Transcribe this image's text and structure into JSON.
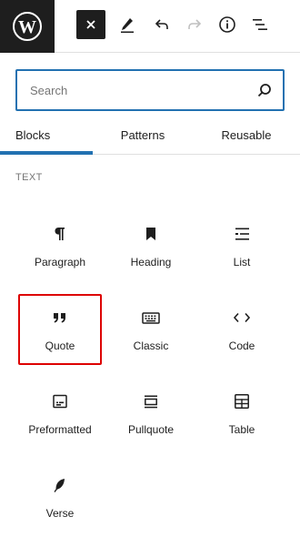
{
  "toolbar": {
    "logo_icon": "wordpress-logo-icon",
    "buttons": [
      "close-icon",
      "pencil-icon",
      "undo-icon",
      "redo-icon",
      "info-icon",
      "list-view-icon"
    ],
    "colors": {
      "dark": "#1e1e1e",
      "accent": "#2271b1",
      "highlight": "#dd0000"
    }
  },
  "search": {
    "placeholder": "Search",
    "value": ""
  },
  "tabs": [
    {
      "label": "Blocks",
      "active": true
    },
    {
      "label": "Patterns",
      "active": false
    },
    {
      "label": "Reusable",
      "active": false
    }
  ],
  "category": {
    "label": "TEXT"
  },
  "blocks": [
    {
      "label": "Paragraph",
      "icon": "paragraph-icon"
    },
    {
      "label": "Heading",
      "icon": "bookmark-icon"
    },
    {
      "label": "List",
      "icon": "list-icon"
    },
    {
      "label": "Quote",
      "icon": "quote-icon",
      "selected": true
    },
    {
      "label": "Classic",
      "icon": "keyboard-icon"
    },
    {
      "label": "Code",
      "icon": "code-icon"
    },
    {
      "label": "Preformatted",
      "icon": "preformatted-icon"
    },
    {
      "label": "Pullquote",
      "icon": "pullquote-icon"
    },
    {
      "label": "Table",
      "icon": "table-icon"
    },
    {
      "label": "Verse",
      "icon": "feather-icon"
    }
  ]
}
